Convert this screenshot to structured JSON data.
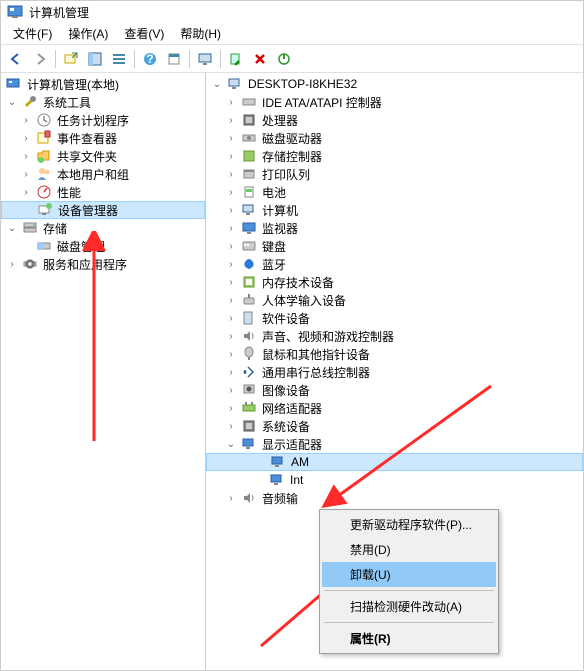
{
  "window": {
    "title": "计算机管理"
  },
  "menu": {
    "file": "文件(F)",
    "action": "操作(A)",
    "view": "查看(V)",
    "help": "帮助(H)"
  },
  "toolbar_icons": [
    "back",
    "forward",
    "up",
    "show-hide",
    "properties",
    "refresh",
    "export",
    "help",
    "details",
    "monitor",
    "separator",
    "scan",
    "delete",
    "enable"
  ],
  "left_tree": {
    "root": "计算机管理(本地)",
    "sys_tools": "系统工具",
    "task_scheduler": "任务计划程序",
    "event_viewer": "事件查看器",
    "shared_folders": "共享文件夹",
    "local_users": "本地用户和组",
    "performance": "性能",
    "device_manager": "设备管理器",
    "storage": "存储",
    "disk_mgmt": "磁盘管理",
    "services_apps": "服务和应用程序"
  },
  "right_tree": {
    "root": "DESKTOP-I8KHE32",
    "items": [
      "IDE ATA/ATAPI 控制器",
      "处理器",
      "磁盘驱动器",
      "存储控制器",
      "打印队列",
      "电池",
      "计算机",
      "监视器",
      "键盘",
      "蓝牙",
      "内存技术设备",
      "人体学输入设备",
      "软件设备",
      "声音、视频和游戏控制器",
      "鼠标和其他指针设备",
      "通用串行总线控制器",
      "图像设备",
      "网络适配器",
      "系统设备",
      "显示适配器"
    ],
    "display_children": {
      "amd_prefix": "AM",
      "intel_prefix": "Int"
    },
    "audio": "音频输"
  },
  "context_menu": {
    "update_driver": "更新驱动程序软件(P)...",
    "disable": "禁用(D)",
    "uninstall": "卸载(U)",
    "scan_hw": "扫描检测硬件改动(A)",
    "properties": "属性(R)"
  },
  "colors": {
    "arrow": "#ff2a2a",
    "highlight": "#91c9f7"
  }
}
